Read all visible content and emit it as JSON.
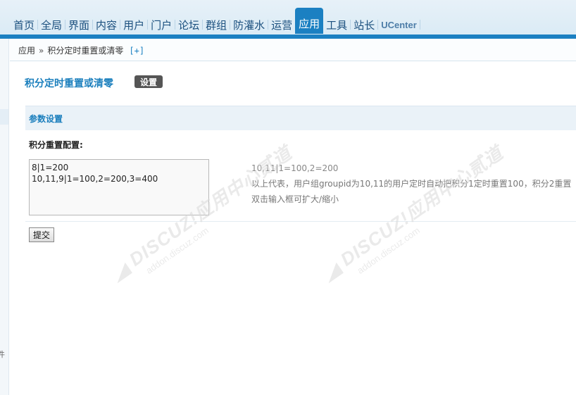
{
  "nav": {
    "items": [
      "首页",
      "全局",
      "界面",
      "内容",
      "用户",
      "门户",
      "论坛",
      "群组",
      "防灌水",
      "运营",
      "应用",
      "工具",
      "站长",
      "UCenter"
    ],
    "active_index": 10
  },
  "breadcrumb": {
    "root": "应用",
    "arrow": "»",
    "current": "积分定时重置或清零",
    "add": "[+]"
  },
  "page": {
    "title": "积分定时重置或清零",
    "settings_button": "设置"
  },
  "section": {
    "header": "参数设置"
  },
  "form": {
    "label": "积分重置配置:",
    "textarea_value": "8|1=200\n10,11,9|1=100,2=200,3=400",
    "tip_example": "10,11|1=100,2=200",
    "tip_desc": "以上代表，用户组groupid为10,11的用户定时自动把积分1定时重置100，积分2重置",
    "tip_dblclick": "双击输入框可扩大/缩小",
    "submit": "提交"
  },
  "watermark": {
    "brand": "DISCUZ!应用中心",
    "vendor": "贰道",
    "url": "addon.discuz.com"
  },
  "colors": {
    "accent": "#1b80c2",
    "title": "#1b7fbd"
  }
}
